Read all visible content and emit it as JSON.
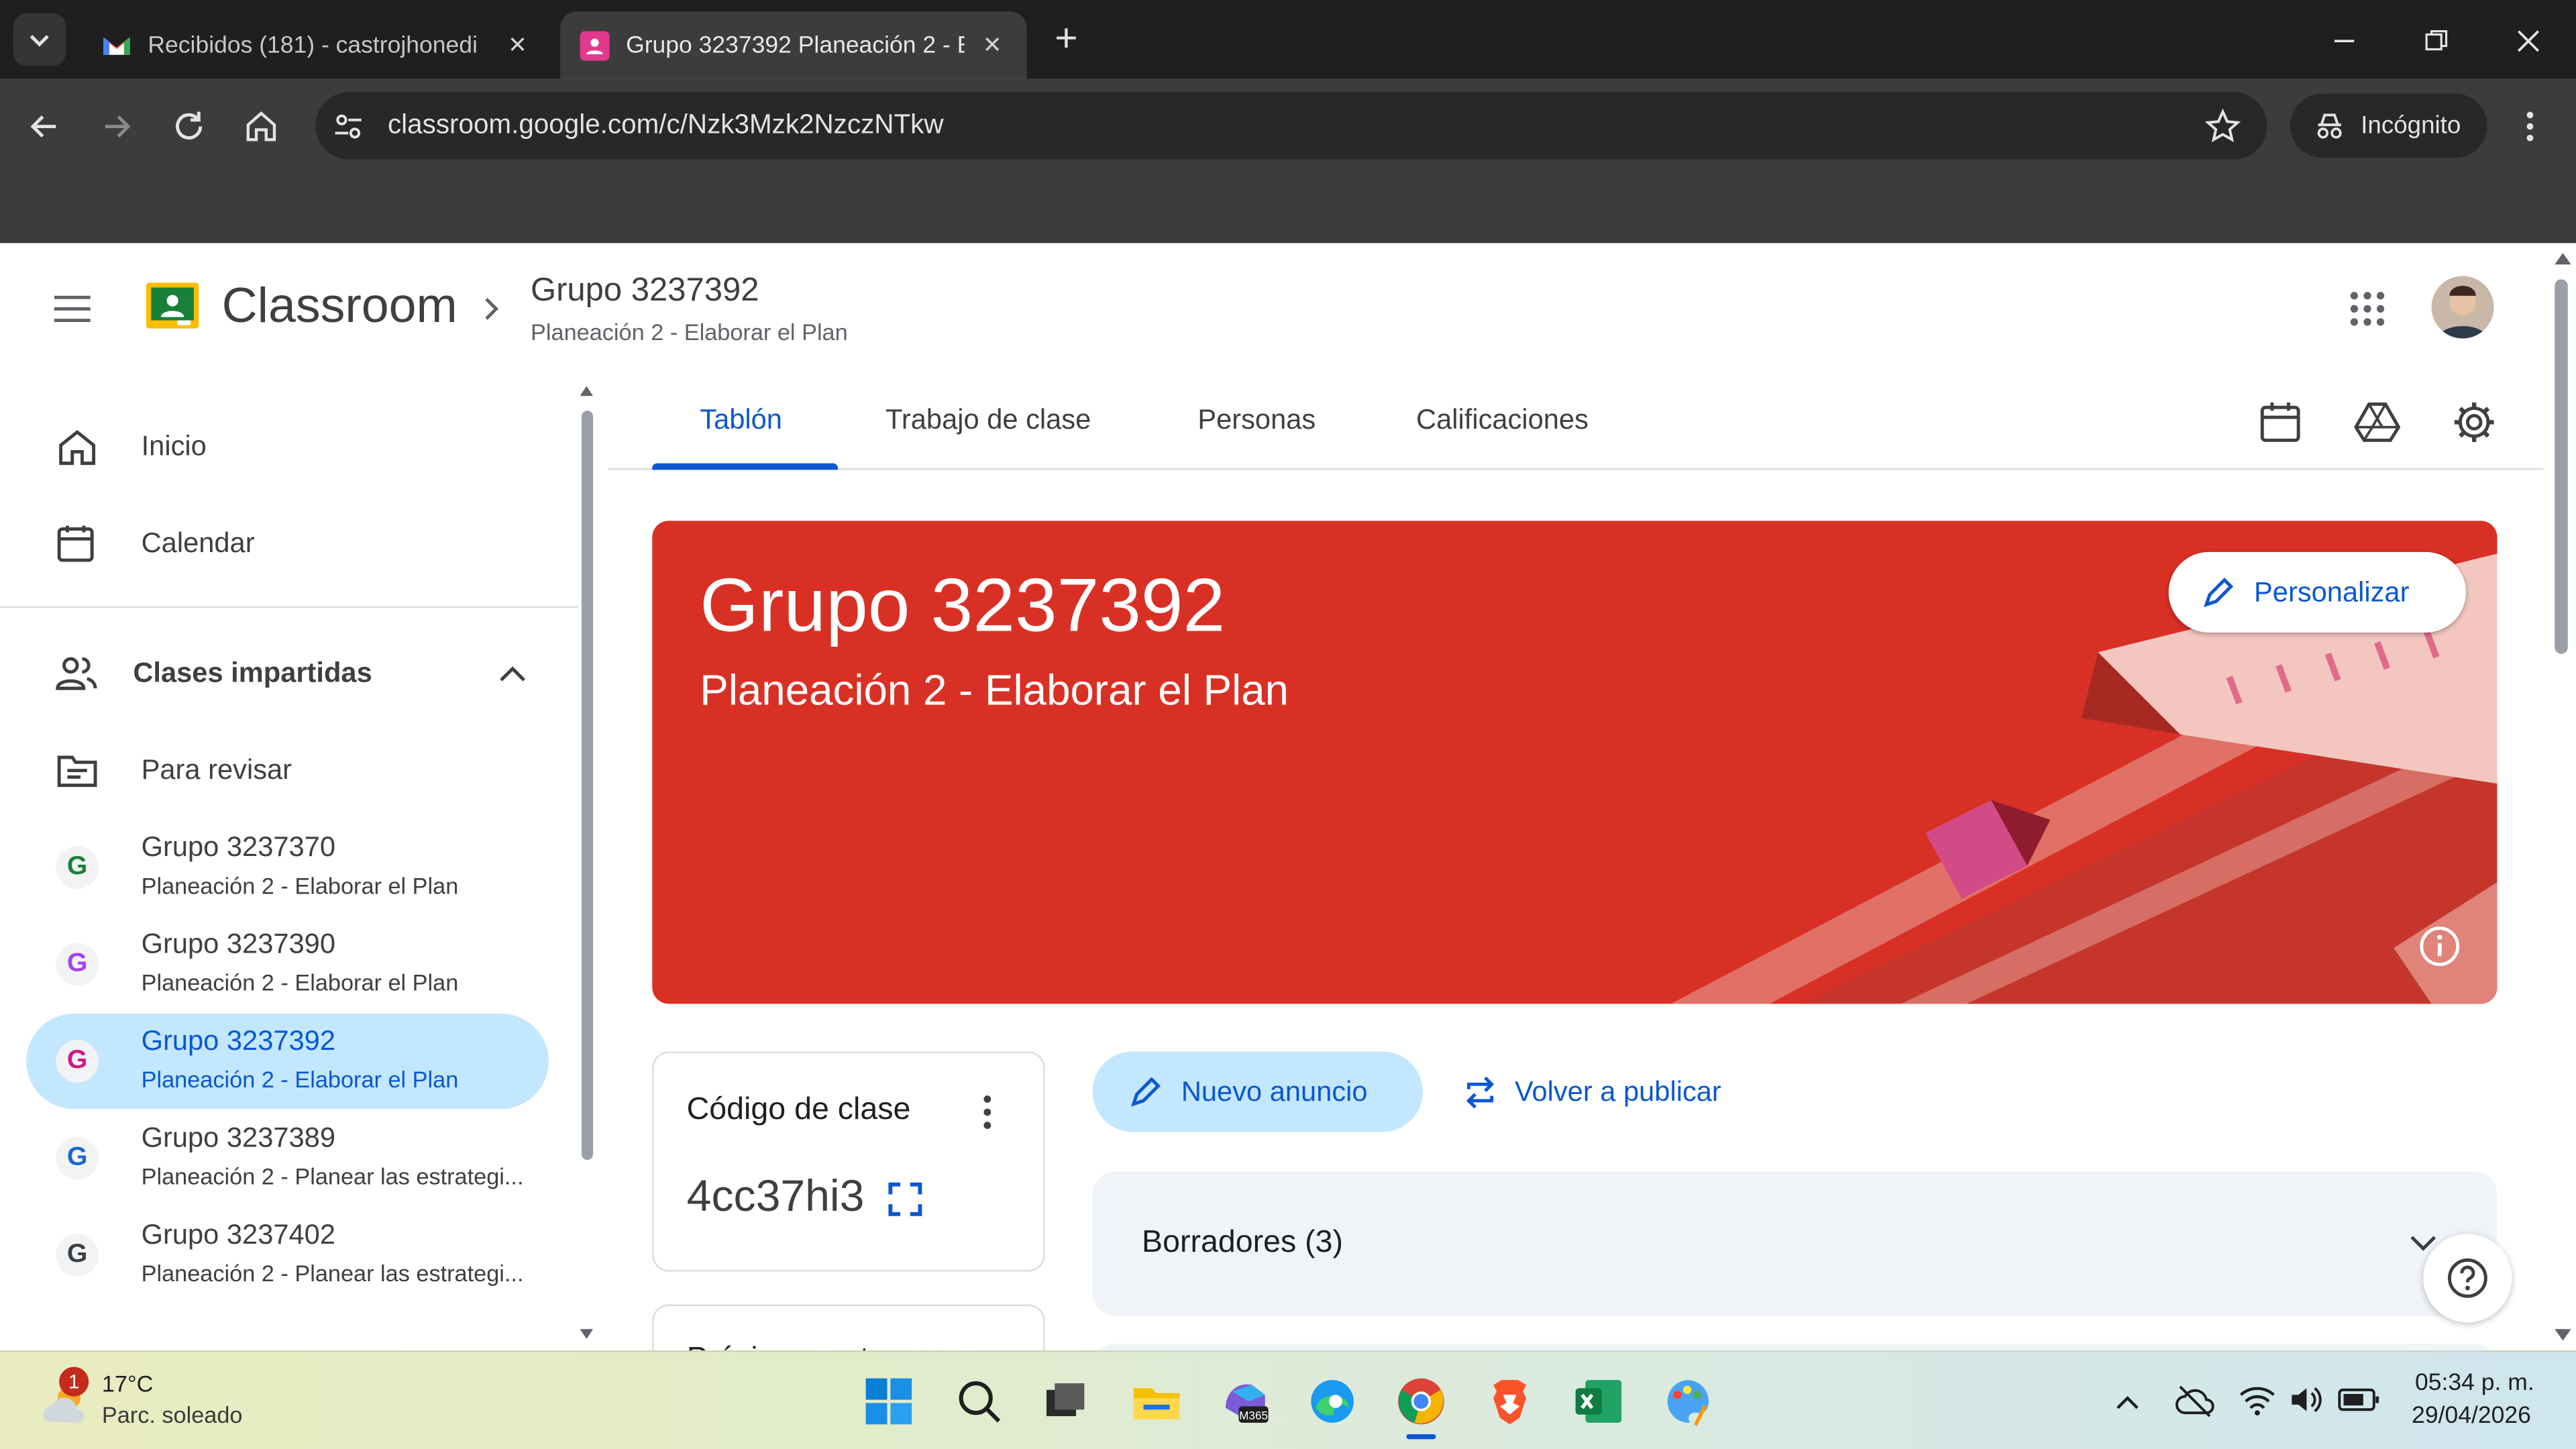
{
  "browser": {
    "tabs": [
      {
        "title": "Recibidos (181) - castrojhonedi",
        "close": "✕"
      },
      {
        "title": "Grupo 3237392 Planeación 2 - E",
        "close": "✕"
      }
    ],
    "new_tab": "+",
    "url": "classroom.google.com/c/Nzk3Mzk2NzczNTkw",
    "incognito_label": "Incógnito"
  },
  "app": {
    "brand": "Classroom",
    "breadcrumb_title": "Grupo 3237392",
    "breadcrumb_subtitle": "Planeación 2 - Elaborar el Plan"
  },
  "sidebar": {
    "home": "Inicio",
    "calendar": "Calendar",
    "teaching_section": "Clases impartidas",
    "to_review": "Para revisar",
    "classes": [
      {
        "avatar": "G",
        "name": "Grupo 3237370",
        "subtitle": "Planeación 2 - Elaborar el Plan",
        "color": "#188038"
      },
      {
        "avatar": "G",
        "name": "Grupo 3237390",
        "subtitle": "Planeación 2 - Elaborar el Plan",
        "color": "#a142f4"
      },
      {
        "avatar": "G",
        "name": "Grupo 3237392",
        "subtitle": "Planeación 2 - Elaborar el Plan",
        "color": "#d01884"
      },
      {
        "avatar": "G",
        "name": "Grupo 3237389",
        "subtitle": "Planeación 2 - Planear las estrategi...",
        "color": "#1967d2"
      },
      {
        "avatar": "G",
        "name": "Grupo 3237402",
        "subtitle": "Planeación 2 - Planear las estrategi...",
        "color": "#3c4043"
      }
    ]
  },
  "tabs": [
    "Tablón",
    "Trabajo de clase",
    "Personas",
    "Calificaciones"
  ],
  "banner": {
    "title": "Grupo 3237392",
    "subtitle": "Planeación 2 - Elaborar el Plan",
    "customize": "Personalizar",
    "color": "#d93025"
  },
  "class_code": {
    "label": "Código de clase",
    "code": "4cc37hi3"
  },
  "next_card_label": "Próximas entregas",
  "actions": {
    "new_announcement": "Nuevo anuncio",
    "repost": "Volver a publicar"
  },
  "drafts": "Borradores (3)",
  "taskbar": {
    "weather_temp": "17°C",
    "weather_desc": "Parc. soleado",
    "weather_badge": "1",
    "time": "05:34 p. m.",
    "date": "29/04/2026"
  }
}
